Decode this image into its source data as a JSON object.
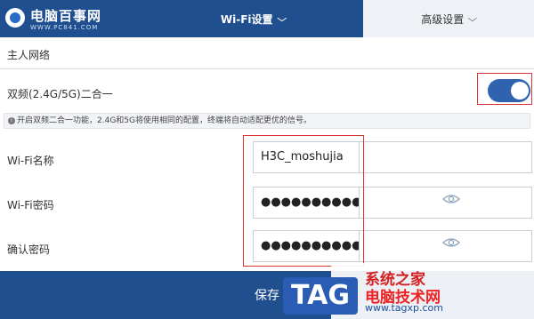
{
  "header": {
    "logo_text": "电脑百事网",
    "logo_url": "WWW.PC841.COM",
    "tabs": [
      {
        "label": "Wi-Fi设置",
        "active": true
      },
      {
        "label": "高级设置",
        "active": false
      }
    ]
  },
  "main": {
    "section_title": "主人网络",
    "dual_band": {
      "label": "双频(2.4G/5G)二合一",
      "enabled": true
    },
    "info_text": "开启双频二合一功能，2.4G和5G将使用相同的配置，终端将自动适配更优的信号。",
    "fields": [
      {
        "label": "Wi-Fi名称",
        "value": "H3C_moshujia",
        "type": "text"
      },
      {
        "label": "Wi-Fi密码",
        "value": "●●●●●●●●●●●",
        "type": "password"
      },
      {
        "label": "确认密码",
        "value": "●●●●●●●●●●●",
        "type": "password"
      }
    ],
    "save_label": "保存"
  },
  "watermark": {
    "tag": "TAG",
    "title": "系统之家",
    "site": "电脑技术网",
    "url": "www.tagxp.com"
  },
  "colors": {
    "brand": "#1f4f8f",
    "toggle_on": "#2f63b0",
    "highlight": "#dd3333"
  }
}
